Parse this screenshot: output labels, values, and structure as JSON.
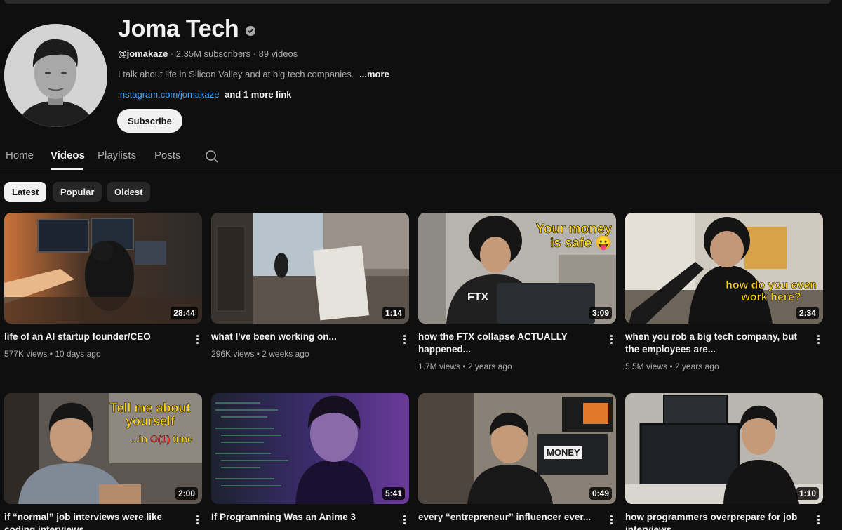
{
  "channel": {
    "name": "Joma Tech",
    "handle": "@jomakaze",
    "subscribers": "2.35M subscribers",
    "videos_count": "89 videos",
    "description": "I talk about life in Silicon Valley and at big tech companies.",
    "more_label": "...more",
    "link": "instagram.com/jomakaze",
    "more_links": "and 1 more link",
    "subscribe_label": "Subscribe"
  },
  "tabs": [
    {
      "label": "Home"
    },
    {
      "label": "Videos"
    },
    {
      "label": "Playlists"
    },
    {
      "label": "Posts"
    }
  ],
  "filters": [
    {
      "label": "Latest"
    },
    {
      "label": "Popular"
    },
    {
      "label": "Oldest"
    }
  ],
  "videos": [
    {
      "title": "life of an AI startup founder/CEO",
      "views": "577K views",
      "age": "10 days ago",
      "duration": "28:44"
    },
    {
      "title": "what I've been working on...",
      "views": "296K views",
      "age": "2 weeks ago",
      "duration": "1:14"
    },
    {
      "title": "how the FTX collapse ACTUALLY happened...",
      "views": "1.7M views",
      "age": "2 years ago",
      "duration": "3:09",
      "overlay": "Your money is safe 😛",
      "brand": "FTX"
    },
    {
      "title": "when you rob a big tech company, but the employees are...",
      "views": "5.5M views",
      "age": "2 years ago",
      "duration": "2:34",
      "overlay": "how do you even work here?"
    },
    {
      "title": "if “normal” job interviews were like coding interviews",
      "duration": "2:00",
      "overlay1": "Tell me about yourself",
      "overlay2_pre": "...in ",
      "overlay2_mid": "O(1)",
      "overlay2_post": " time"
    },
    {
      "title": "If Programming Was an Anime 3",
      "duration": "5:41"
    },
    {
      "title": "every “entrepreneur” influencer ever...",
      "duration": "0:49",
      "sign": "MONEY"
    },
    {
      "title": "how programmers overprepare for job interviews",
      "duration": "1:10"
    }
  ],
  "colors": {
    "background": "#0f0f0f",
    "link": "#3ea6ff",
    "muted": "#aaaaaa",
    "text": "#f1f1f1",
    "overlay_yellow": "#ffd400"
  }
}
